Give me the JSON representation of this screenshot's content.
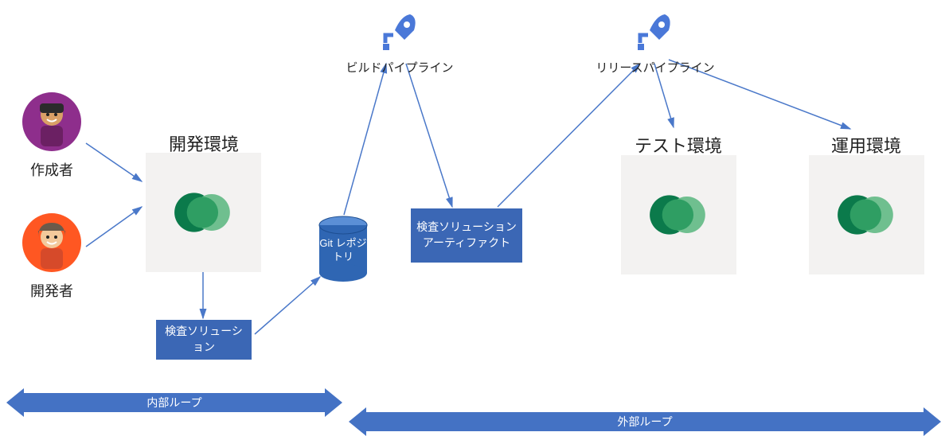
{
  "actors": {
    "maker": {
      "label": "作成者"
    },
    "developer": {
      "label": "開発者"
    }
  },
  "pipelines": {
    "build": {
      "label": "ビルドパイプライン"
    },
    "release": {
      "label": "リリースパイプライン"
    }
  },
  "environments": {
    "dev": {
      "title": "開発環境"
    },
    "test": {
      "title": "テスト環境"
    },
    "prod": {
      "title": "運用環境"
    }
  },
  "nodes": {
    "check_solution": {
      "label": "検査ソリューション"
    },
    "git_repo": {
      "label": "Git レポジトリ"
    },
    "check_artifact": {
      "label": "検査ソリューションアーティファクト"
    }
  },
  "loops": {
    "inner": {
      "label": "内部ループ"
    },
    "outer": {
      "label": "外部ループ"
    }
  }
}
